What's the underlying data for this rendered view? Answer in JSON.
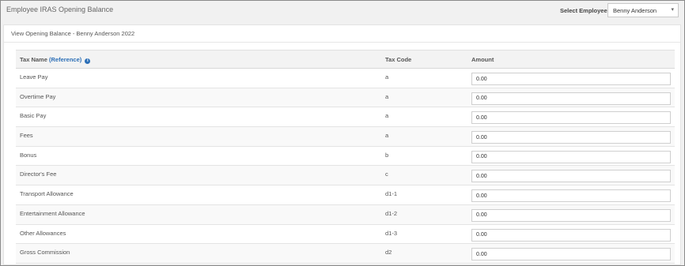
{
  "page": {
    "title": "Employee IRAS Opening Balance",
    "select_label": "Select Employee:",
    "selected_employee": "Benny Anderson"
  },
  "panel": {
    "title": "View Opening Balance - Benny Anderson 2022"
  },
  "table": {
    "headers": {
      "name_prefix": "Tax Name",
      "reference": "(Reference)",
      "code": "Tax Code",
      "amount": "Amount"
    },
    "rows": [
      {
        "name": "Leave Pay",
        "code": "a",
        "amount": "0.00"
      },
      {
        "name": "Overtime Pay",
        "code": "a",
        "amount": "0.00"
      },
      {
        "name": "Basic Pay",
        "code": "a",
        "amount": "0.00"
      },
      {
        "name": "Fees",
        "code": "a",
        "amount": "0.00"
      },
      {
        "name": "Bonus",
        "code": "b",
        "amount": "0.00"
      },
      {
        "name": "Director's Fee",
        "code": "c",
        "amount": "0.00"
      },
      {
        "name": "Transport Allowance",
        "code": "d1-1",
        "amount": "0.00"
      },
      {
        "name": "Entertainment Allowance",
        "code": "d1-2",
        "amount": "0.00"
      },
      {
        "name": "Other Allowances",
        "code": "d1-3",
        "amount": "0.00"
      },
      {
        "name": "Gross Commission",
        "code": "d2",
        "amount": "0.00"
      }
    ]
  },
  "icons": {
    "info": "info-icon",
    "caret": "chevron-down-icon"
  }
}
